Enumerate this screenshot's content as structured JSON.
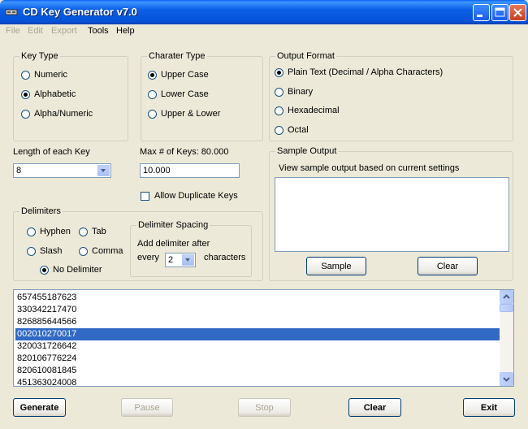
{
  "window": {
    "title": "CD Key Generator v7.0"
  },
  "menu": [
    "File",
    "Edit",
    "Export",
    "Tools",
    "Help"
  ],
  "key_type": {
    "legend": "Key Type",
    "options": [
      "Numeric",
      "Alphabetic",
      "Alpha/Numeric"
    ],
    "selected": "Alphabetic"
  },
  "char_type": {
    "legend": "Charater Type",
    "options": [
      "Upper Case",
      "Lower Case",
      "Upper & Lower"
    ],
    "selected": "Upper Case"
  },
  "output_format": {
    "legend": "Output Format",
    "options": [
      "Plain Text (Decimal / Alpha Characters)",
      "Binary",
      "Hexadecimal",
      "Octal"
    ],
    "selected": "Plain Text (Decimal / Alpha Characters)"
  },
  "length": {
    "label": "Length of each Key",
    "value": "8"
  },
  "max_keys": {
    "label": "Max # of Keys: 80.000",
    "value": "10.000"
  },
  "allow_duplicates": {
    "label": "Allow Duplicate Keys",
    "checked": false
  },
  "delimiters": {
    "legend": "Delimiters",
    "options": [
      "Hyphen",
      "Tab",
      "Slash",
      "Comma",
      "No Delimiter"
    ],
    "selected": "No Delimiter"
  },
  "delimiter_spacing": {
    "legend": "Delimiter Spacing",
    "line1": "Add delimiter after",
    "every": "every",
    "value": "2",
    "characters": "characters"
  },
  "sample_output": {
    "legend": "Sample Output",
    "description": "View sample output based on current settings",
    "sample_button": "Sample",
    "clear_button": "Clear"
  },
  "keys": [
    "657455187623",
    "330342217470",
    "826885644566",
    "002010270017",
    "320031726642",
    "820106776224",
    "820610081845",
    "451363024008"
  ],
  "selected_key": "002010270017",
  "buttons": {
    "generate": "Generate",
    "pause": "Pause",
    "stop": "Stop",
    "clear": "Clear",
    "exit": "Exit"
  },
  "colors": {
    "titlebar": "#0553D9",
    "selection": "#316AC5",
    "window_bg": "#ECE9D8"
  }
}
